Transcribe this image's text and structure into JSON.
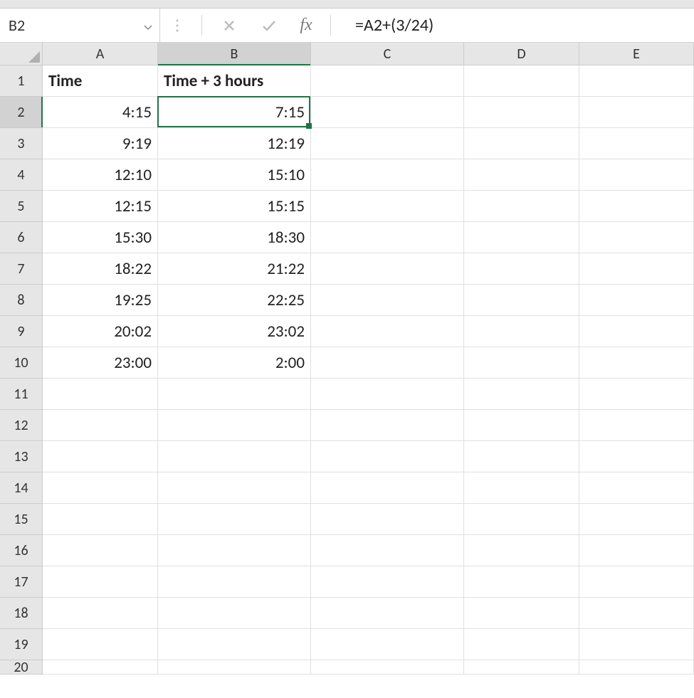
{
  "formula_bar": {
    "name_box": "B2",
    "formula": "=A2+(3/24)",
    "fx_label": "fx"
  },
  "columns": [
    "A",
    "B",
    "C",
    "D",
    "E"
  ],
  "row_count": 20,
  "selected_cell": {
    "col": "B",
    "row": 2
  },
  "headers": {
    "A": "Time",
    "B": "Time + 3 hours"
  },
  "cells": {
    "A2": "4:15",
    "B2": "7:15",
    "A3": "9:19",
    "B3": "12:19",
    "A4": "12:10",
    "B4": "15:10",
    "A5": "12:15",
    "B5": "15:15",
    "A6": "15:30",
    "B6": "18:30",
    "A7": "18:22",
    "B7": "21:22",
    "A8": "19:25",
    "B8": "22:25",
    "A9": "20:02",
    "B9": "23:02",
    "A10": "23:00",
    "B10": "2:00"
  }
}
